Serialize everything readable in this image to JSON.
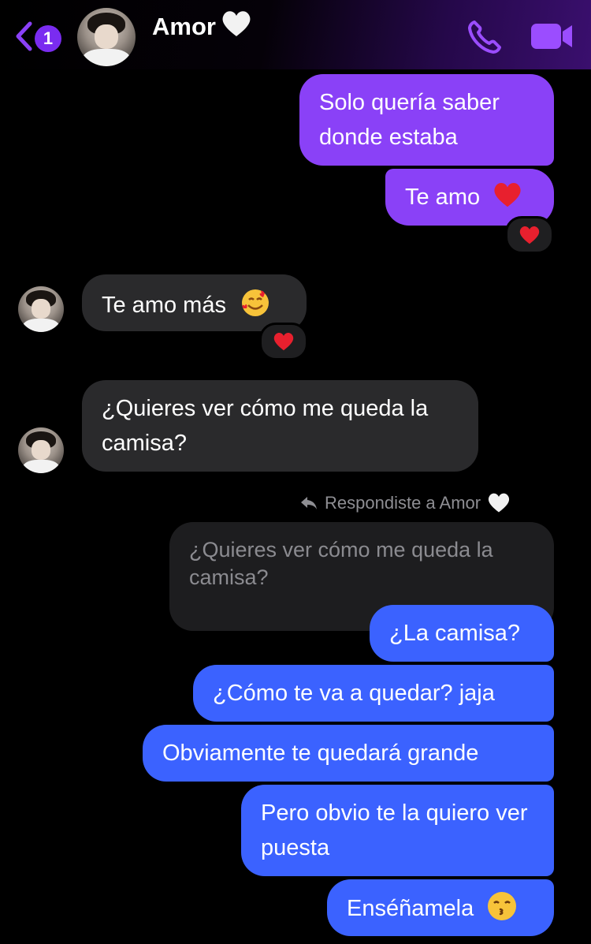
{
  "header": {
    "unread_count": "1",
    "contact_name": "Amor",
    "accent_color": "#8a41f7"
  },
  "messages": [
    {
      "id": "m1",
      "sender": "me",
      "text": "Solo quería saber donde estaba"
    },
    {
      "id": "m2",
      "sender": "me",
      "text": "Te amo",
      "emoji": "red-heart",
      "reaction": "red-heart"
    },
    {
      "id": "m3",
      "sender": "contact",
      "text": "Te amo más",
      "emoji": "smiling-face-with-hearts",
      "reaction": "red-heart"
    },
    {
      "id": "m4",
      "sender": "contact",
      "text": "¿Quieres ver cómo me queda la camisa?"
    },
    {
      "id": "reply",
      "label": "Respondiste a Amor",
      "quoted": "¿Quieres ver cómo me queda la camisa?"
    },
    {
      "id": "m5",
      "sender": "me",
      "text": "¿La camisa?"
    },
    {
      "id": "m6",
      "sender": "me",
      "text": "¿Cómo te va a quedar? jaja"
    },
    {
      "id": "m7",
      "sender": "me",
      "text": "Obviamente te quedará grande"
    },
    {
      "id": "m8",
      "sender": "me",
      "text": "Pero obvio te la quiero ver puesta"
    },
    {
      "id": "m9",
      "sender": "me",
      "text": "Enséñamela",
      "emoji": "kissing-face"
    }
  ],
  "colors": {
    "sent_purple": "#8a41f7",
    "sent_blue": "#3b62ff",
    "received_gray": "#2a2a2c",
    "quote_bg": "#1d1d1f"
  }
}
